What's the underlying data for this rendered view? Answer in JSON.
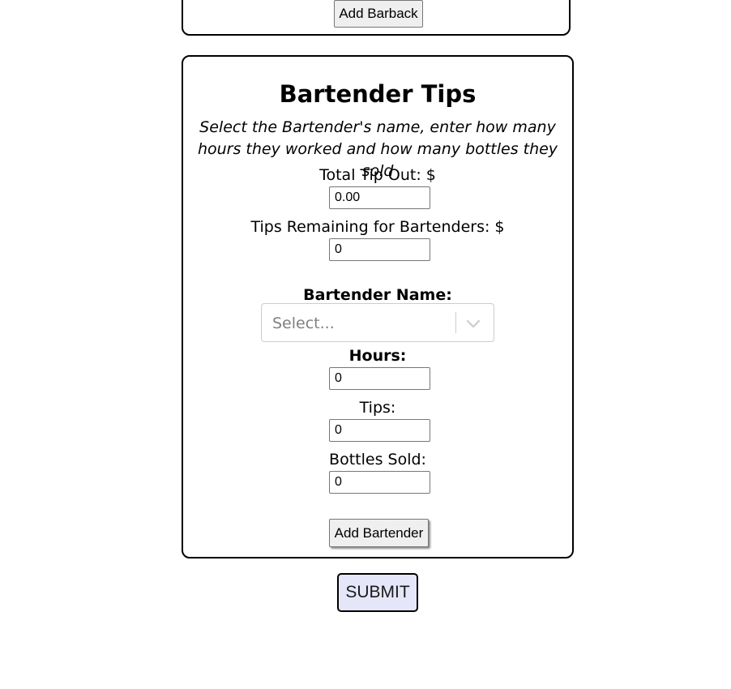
{
  "barback_section": {
    "add_button_label": "Add Barback"
  },
  "bartender_section": {
    "title": "Bartender Tips",
    "instructions": "Select the Bartender's name, enter how many hours they worked and how many bottles they sold",
    "total_tip_out": {
      "label": "Total Tip Out: $",
      "value": "0.00"
    },
    "tips_remaining": {
      "label": "Tips Remaining for Bartenders: $",
      "value": "0"
    },
    "bartender_name": {
      "label": "Bartender Name:",
      "placeholder": "Select..."
    },
    "hours": {
      "label": "Hours:",
      "value": "0"
    },
    "tips": {
      "label": "Tips:",
      "value": "0"
    },
    "bottles_sold": {
      "label": "Bottles Sold:",
      "value": "0"
    },
    "add_button_label": "Add Bartender"
  },
  "submit_label": "SUBMIT",
  "colors": {
    "submit_background": "#e6e6fa",
    "border": "#000000",
    "button_gray": "#efefef",
    "placeholder": "#808080"
  },
  "icons": {
    "select_indicator": "chevron-down-icon"
  }
}
